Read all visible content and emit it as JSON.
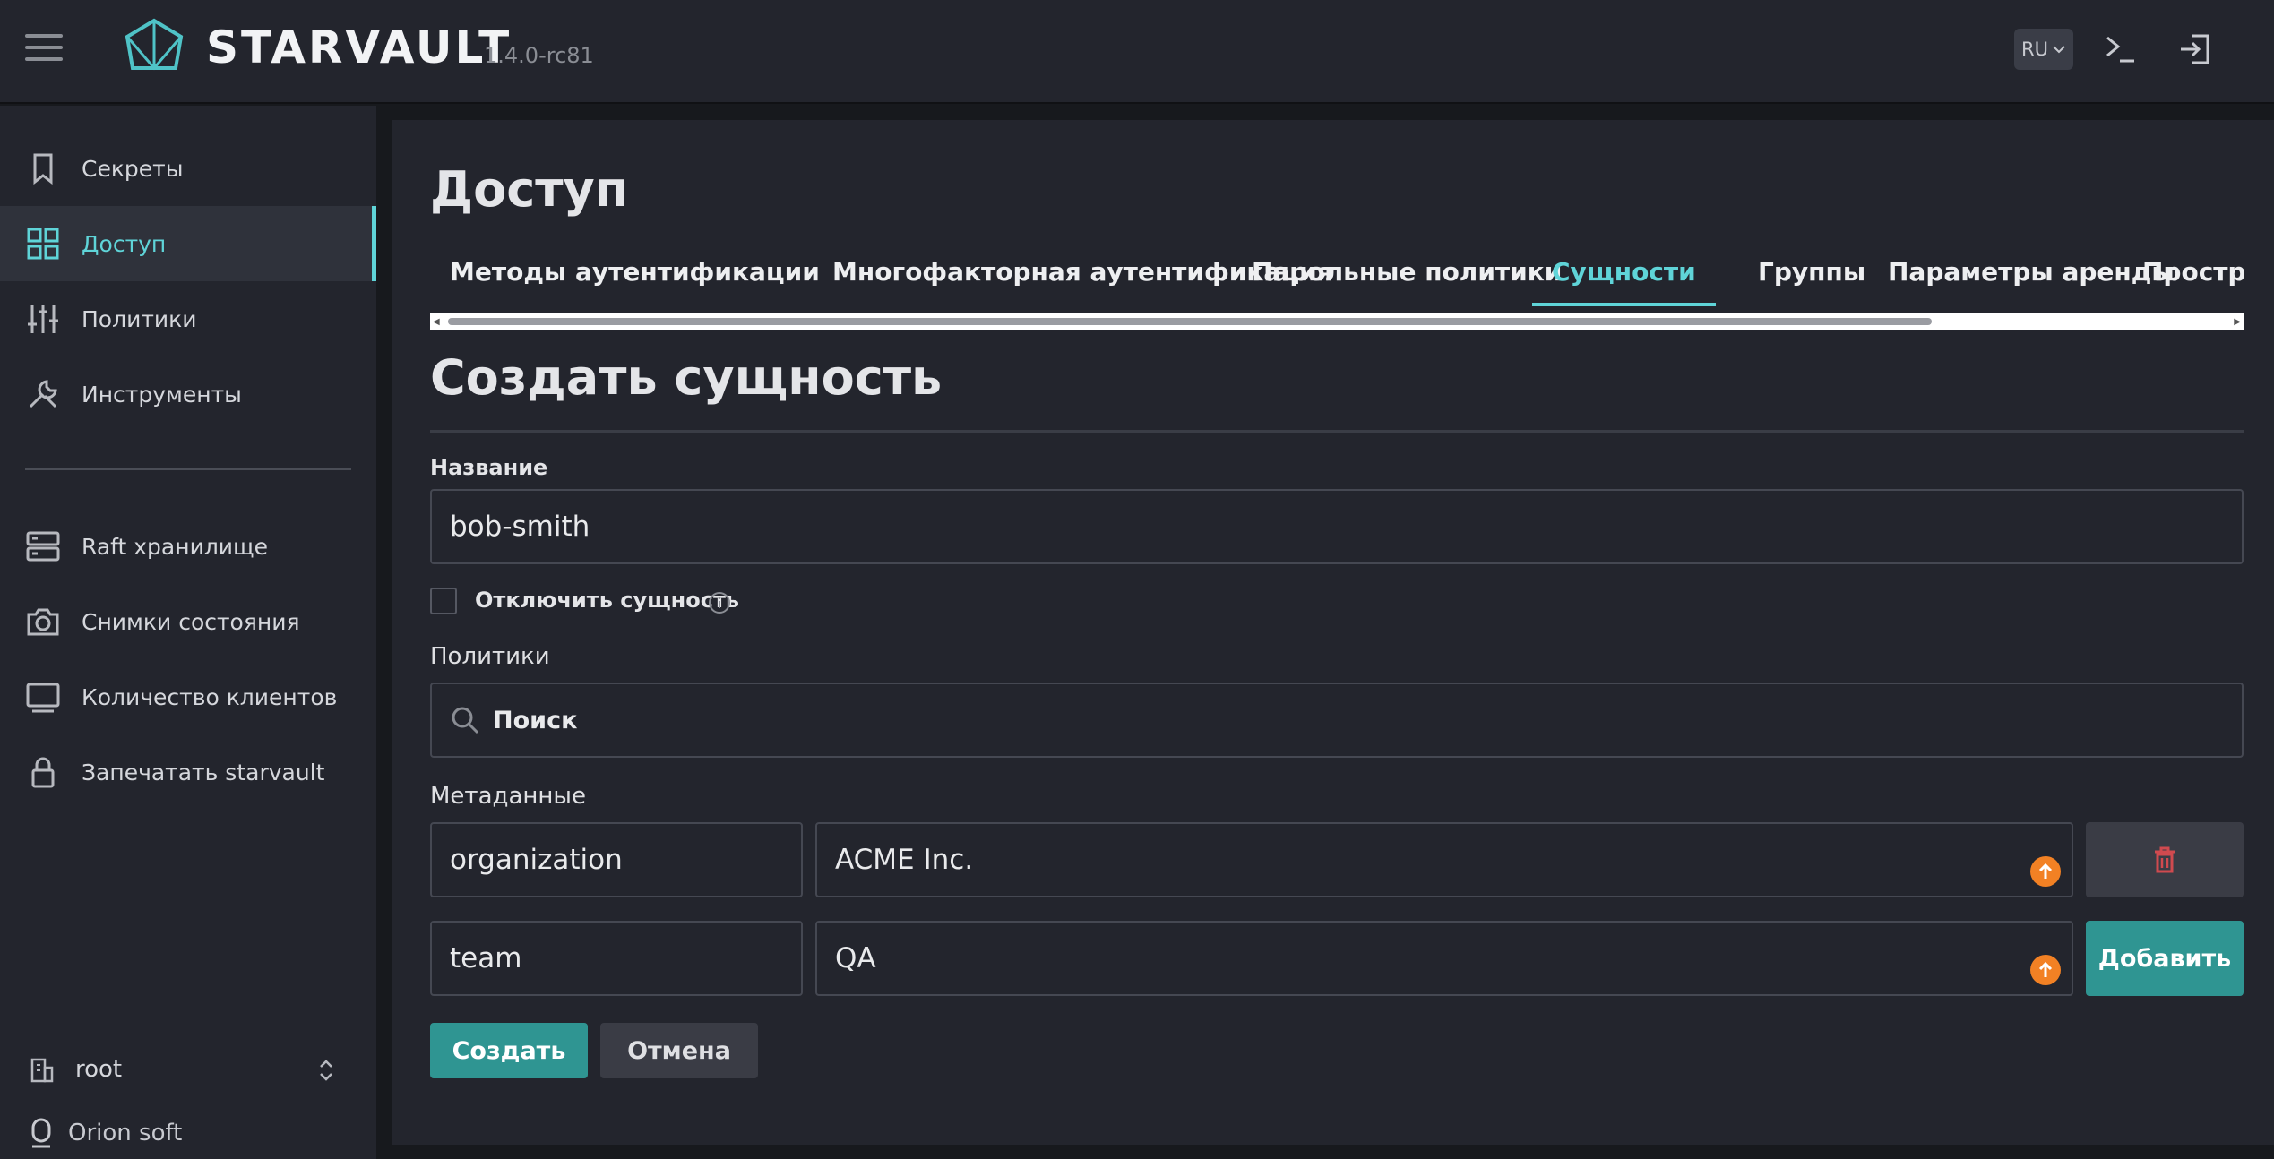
{
  "header": {
    "app_name": "STARVAULT",
    "version": "1.4.0-rc81",
    "language": "RU",
    "icons": [
      "menu-icon",
      "terminal-icon",
      "logout-icon"
    ]
  },
  "sidebar": {
    "items": [
      {
        "label": "Секреты",
        "icon": "bookmark-icon"
      },
      {
        "label": "Доступ",
        "icon": "grid-icon",
        "active": true
      },
      {
        "label": "Политики",
        "icon": "sliders-icon"
      },
      {
        "label": "Инструменты",
        "icon": "wrench-icon"
      }
    ],
    "system_items": [
      {
        "label": "Raft хранилище",
        "icon": "server-icon"
      },
      {
        "label": "Снимки состояния",
        "icon": "camera-icon"
      },
      {
        "label": "Количество клиентов",
        "icon": "monitor-icon"
      },
      {
        "label": "Запечатать starvault",
        "icon": "lock-icon"
      }
    ],
    "namespace": "root",
    "brand": "Orion soft"
  },
  "main": {
    "title": "Доступ",
    "tabs": [
      {
        "label": "Методы аутентификации"
      },
      {
        "label": "Многофакторная аутентификация"
      },
      {
        "label": "Парольные политики"
      },
      {
        "label": "Сущности",
        "active": true
      },
      {
        "label": "Группы"
      },
      {
        "label": "Параметры аренды"
      },
      {
        "label": "Пространст"
      }
    ],
    "form": {
      "title": "Создать сущность",
      "name_label": "Название",
      "name_value": "bob-smith",
      "disable_label": "Отключить сущность",
      "policies_label": "Политики",
      "search_placeholder": "Поиск",
      "metadata_label": "Метаданные",
      "metadata": [
        {
          "key": "organization",
          "value": "ACME Inc."
        },
        {
          "key": "team",
          "value": "QA"
        }
      ],
      "add_label": "Добавить",
      "create_label": "Создать",
      "cancel_label": "Отмена"
    }
  },
  "colors": {
    "accent": "#5fd4d8",
    "primary_button": "#2f9592",
    "badge": "#f28124",
    "delete": "#d04a4f"
  }
}
